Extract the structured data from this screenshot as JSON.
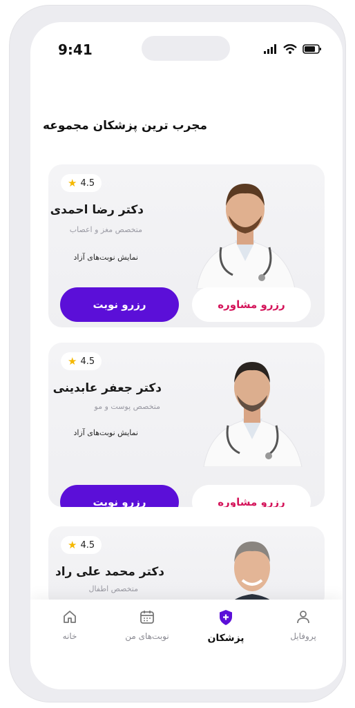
{
  "status_bar": {
    "time": "9:41"
  },
  "section_title": "مجرب ترین پزشکان مجموعه",
  "doctors": [
    {
      "rating": "4.5",
      "name": "دکتر رضا احمدی",
      "specialty": "متخصص مغز و اعصاب",
      "free_slots": "نمایش نوبت‌های آزاد",
      "consult_label": "رزرو مشاوره",
      "reserve_label": "رزرو نوبت"
    },
    {
      "rating": "4.5",
      "name": "دکتر جعفر عابدینی",
      "specialty": "متخصص پوست و مو",
      "free_slots": "نمایش نوبت‌های آزاد",
      "consult_label": "رزرو مشاوره",
      "reserve_label": "رزرو نوبت"
    },
    {
      "rating": "4.5",
      "name": "دکتر محمد علی راد",
      "specialty": "متخصص اطفال"
    }
  ],
  "nav": {
    "items": [
      {
        "label": "پروفایل",
        "icon": "user-icon"
      },
      {
        "label": "پزشکان",
        "icon": "shield-plus-icon",
        "active": true
      },
      {
        "label": "نوبت‌های من",
        "icon": "calendar-icon"
      },
      {
        "label": "خانه",
        "icon": "home-icon"
      }
    ]
  },
  "colors": {
    "primary": "#5b0fd8",
    "accent": "#d4145a",
    "star": "#f5b800"
  }
}
